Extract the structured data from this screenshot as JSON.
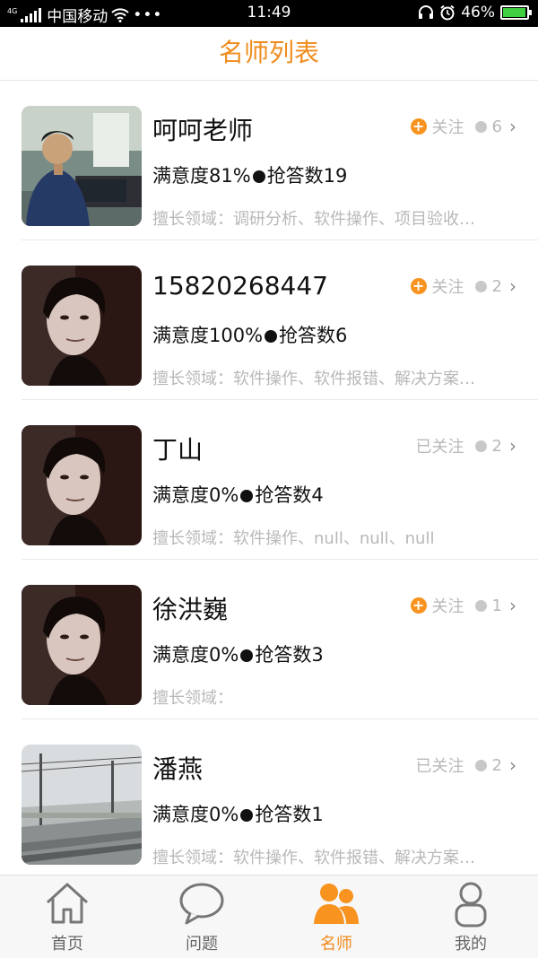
{
  "status_bar": {
    "carrier": "中国移动",
    "network": "4G",
    "time": "11:49",
    "battery": "46%",
    "icons": [
      "signal-icon",
      "wifi-icon",
      "more-icon",
      "headset-icon",
      "alarm-icon",
      "battery-icon"
    ]
  },
  "header": {
    "title": "名师列表"
  },
  "teachers": [
    {
      "name": "呵呵老师",
      "satisfaction": "满意度81%",
      "answers": "抢答数19",
      "expertise": "擅长领域：调研分析、软件操作、项目验收…",
      "follow_label": "关注",
      "followed": false,
      "count": "6",
      "avatar": "office-photo"
    },
    {
      "name": "15820268447",
      "satisfaction": "满意度100%",
      "answers": "抢答数6",
      "expertise": "擅长领域：软件操作、软件报错、解决方案…",
      "follow_label": "关注",
      "followed": false,
      "count": "2",
      "avatar": "portrait-photo"
    },
    {
      "name": "丁山",
      "satisfaction": "满意度0%",
      "answers": "抢答数4",
      "expertise": "擅长领域：软件操作、null、null、null",
      "follow_label": "已关注",
      "followed": true,
      "count": "2",
      "avatar": "portrait-photo"
    },
    {
      "name": "徐洪巍",
      "satisfaction": "满意度0%",
      "answers": "抢答数3",
      "expertise": "擅长领域：",
      "follow_label": "关注",
      "followed": false,
      "count": "1",
      "avatar": "portrait-photo"
    },
    {
      "name": "潘燕",
      "satisfaction": "满意度0%",
      "answers": "抢答数1",
      "expertise": "擅长领域：软件操作、软件报错、解决方案…",
      "follow_label": "已关注",
      "followed": true,
      "count": "2",
      "avatar": "railway-photo"
    }
  ],
  "tabbar": {
    "tabs": [
      {
        "label": "首页",
        "icon": "home-icon",
        "active": false
      },
      {
        "label": "问题",
        "icon": "chat-bubble-icon",
        "active": false
      },
      {
        "label": "名师",
        "icon": "teachers-icon",
        "active": true
      },
      {
        "label": "我的",
        "icon": "person-icon",
        "active": false
      }
    ]
  },
  "colors": {
    "accent": "#f08c1c",
    "plus_badge": "#f7931e",
    "muted_text": "#b8b8b8"
  }
}
